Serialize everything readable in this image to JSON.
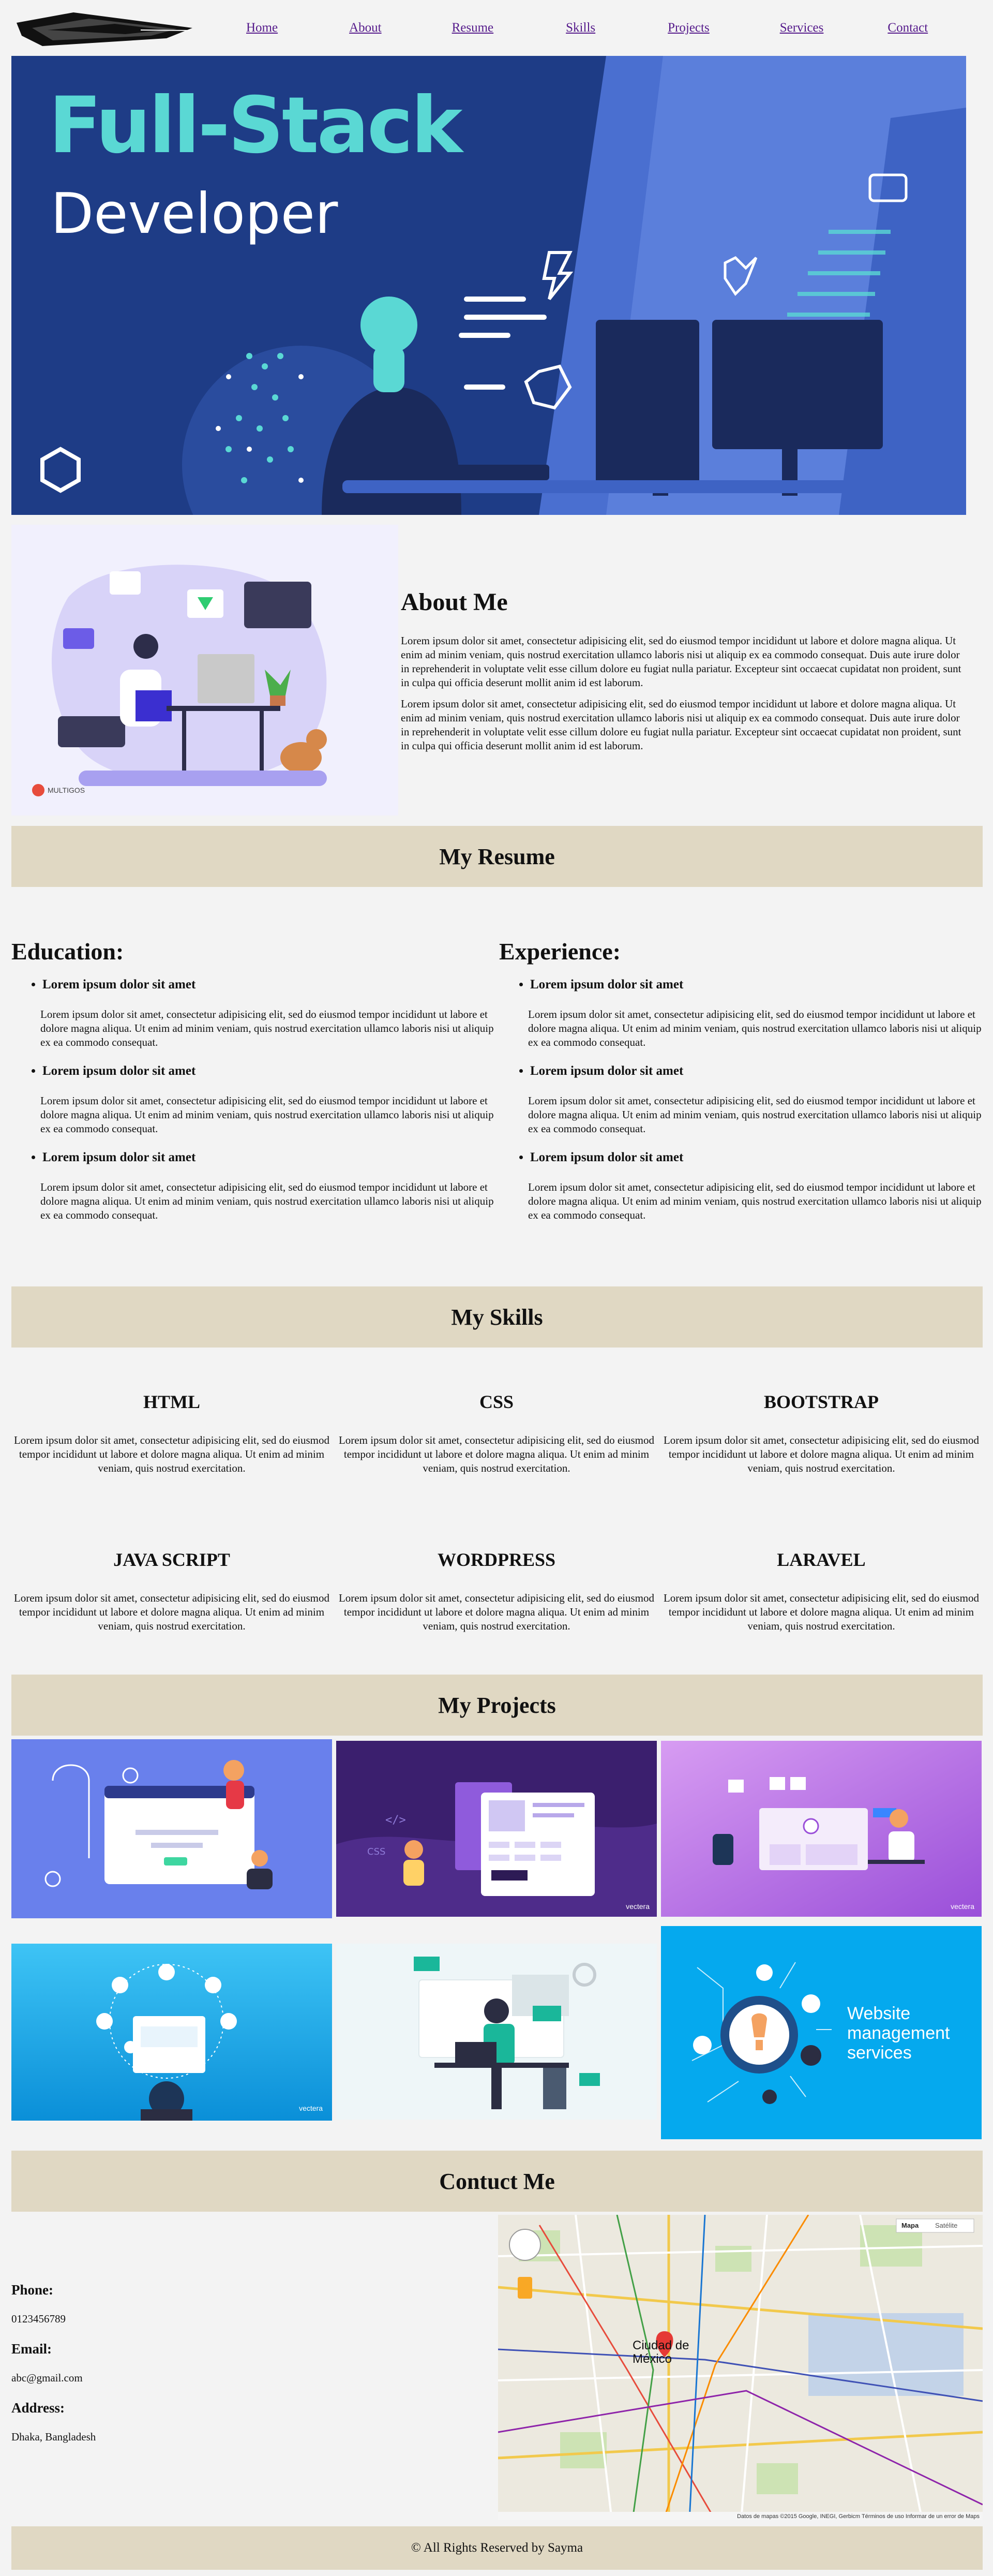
{
  "nav": {
    "links": [
      "Home",
      "About",
      "Resume",
      "Skills",
      "Projects",
      "Services",
      "Contact"
    ]
  },
  "hero": {
    "title_line1": "Full-Stack",
    "title_line2": "Developer"
  },
  "about": {
    "heading": "About Me",
    "paragraphs": [
      "Lorem ipsum dolor sit amet, consectetur adipisicing elit, sed do eiusmod tempor incididunt ut labore et dolore magna aliqua. Ut enim ad minim veniam, quis nostrud exercitation ullamco laboris nisi ut aliquip ex ea commodo consequat. Duis aute irure dolor in reprehenderit in voluptate velit esse cillum dolore eu fugiat nulla pariatur. Excepteur sint occaecat cupidatat non proident, sunt in culpa qui officia deserunt mollit anim id est laborum.",
      "Lorem ipsum dolor sit amet, consectetur adipisicing elit, sed do eiusmod tempor incididunt ut labore et dolore magna aliqua. Ut enim ad minim veniam, quis nostrud exercitation ullamco laboris nisi ut aliquip ex ea commodo consequat. Duis aute irure dolor in reprehenderit in voluptate velit esse cillum dolore eu fugiat nulla pariatur. Excepteur sint occaecat cupidatat non proident, sunt in culpa qui officia deserunt mollit anim id est laborum."
    ],
    "brand": "MULTIGOS"
  },
  "resume": {
    "heading": "My Resume",
    "education": {
      "heading": "Education:",
      "items": [
        {
          "title": "Lorem ipsum dolor sit amet",
          "text": "Lorem ipsum dolor sit amet, consectetur adipisicing elit, sed do eiusmod tempor incididunt ut labore et dolore magna aliqua. Ut enim ad minim veniam, quis nostrud exercitation ullamco laboris nisi ut aliquip ex ea commodo consequat."
        },
        {
          "title": "Lorem ipsum dolor sit amet",
          "text": "Lorem ipsum dolor sit amet, consectetur adipisicing elit, sed do eiusmod tempor incididunt ut labore et dolore magna aliqua. Ut enim ad minim veniam, quis nostrud exercitation ullamco laboris nisi ut aliquip ex ea commodo consequat."
        },
        {
          "title": "Lorem ipsum dolor sit amet",
          "text": "Lorem ipsum dolor sit amet, consectetur adipisicing elit, sed do eiusmod tempor incididunt ut labore et dolore magna aliqua. Ut enim ad minim veniam, quis nostrud exercitation ullamco laboris nisi ut aliquip ex ea commodo consequat."
        }
      ]
    },
    "experience": {
      "heading": "Experience:",
      "items": [
        {
          "title": "Lorem ipsum dolor sit amet",
          "text": "Lorem ipsum dolor sit amet, consectetur adipisicing elit, sed do eiusmod tempor incididunt ut labore et dolore magna aliqua. Ut enim ad minim veniam, quis nostrud exercitation ullamco laboris nisi ut aliquip ex ea commodo consequat."
        },
        {
          "title": "Lorem ipsum dolor sit amet",
          "text": "Lorem ipsum dolor sit amet, consectetur adipisicing elit, sed do eiusmod tempor incididunt ut labore et dolore magna aliqua. Ut enim ad minim veniam, quis nostrud exercitation ullamco laboris nisi ut aliquip ex ea commodo consequat."
        },
        {
          "title": "Lorem ipsum dolor sit amet",
          "text": "Lorem ipsum dolor sit amet, consectetur adipisicing elit, sed do eiusmod tempor incididunt ut labore et dolore magna aliqua. Ut enim ad minim veniam, quis nostrud exercitation ullamco laboris nisi ut aliquip ex ea commodo consequat."
        }
      ]
    }
  },
  "skills": {
    "heading": "My Skills",
    "items": [
      {
        "name": "HTML",
        "text": "Lorem ipsum dolor sit amet, consectetur adipisicing elit, sed do eiusmod tempor incididunt ut labore et dolore magna aliqua. Ut enim ad minim veniam, quis nostrud exercitation."
      },
      {
        "name": "CSS",
        "text": "Lorem ipsum dolor sit amet, consectetur adipisicing elit, sed do eiusmod tempor incididunt ut labore et dolore magna aliqua. Ut enim ad minim veniam, quis nostrud exercitation."
      },
      {
        "name": "BOOTSTRAP",
        "text": "Lorem ipsum dolor sit amet, consectetur adipisicing elit, sed do eiusmod tempor incididunt ut labore et dolore magna aliqua. Ut enim ad minim veniam, quis nostrud exercitation."
      },
      {
        "name": "JAVA SCRIPT",
        "text": "Lorem ipsum dolor sit amet, consectetur adipisicing elit, sed do eiusmod tempor incididunt ut labore et dolore magna aliqua. Ut enim ad minim veniam, quis nostrud exercitation."
      },
      {
        "name": "WORDPRESS",
        "text": "Lorem ipsum dolor sit amet, consectetur adipisicing elit, sed do eiusmod tempor incididunt ut labore et dolore magna aliqua. Ut enim ad minim veniam, quis nostrud exercitation."
      },
      {
        "name": "LARAVEL",
        "text": "Lorem ipsum dolor sit amet, consectetur adipisicing elit, sed do eiusmod tempor incididunt ut labore et dolore magna aliqua. Ut enim ad minim veniam, quis nostrud exercitation."
      }
    ]
  },
  "projects": {
    "heading": "My Projects",
    "tiles": [
      {
        "caption": ""
      },
      {
        "caption": "vectera"
      },
      {
        "caption": "vectera"
      },
      {
        "caption": "vectera"
      },
      {
        "caption": ""
      },
      {
        "caption": "Website management services"
      }
    ]
  },
  "contact": {
    "heading": "Contuct Me",
    "phone_label": "Phone:",
    "phone": "0123456789",
    "email_label": "Email:",
    "email": "abc@gmail.com",
    "address_label": "Address:",
    "address": "Dhaka, Bangladesh",
    "map": {
      "type_map": "Mapa",
      "type_satellite": "Satélite",
      "city_label": "Ciudad de México",
      "attribution": "Datos de mapas ©2015 Google, INEGI, Gerbicm   Términos de uso   Informar de un error de Maps"
    }
  },
  "footer": {
    "text": "© All Rights Reserved by Sayma"
  },
  "colors": {
    "section_bar": "#e0d8c3",
    "page_bg": "#f3f3f3",
    "hero_bg": "#1e3c86",
    "hero_teal": "#5ad8d4"
  }
}
